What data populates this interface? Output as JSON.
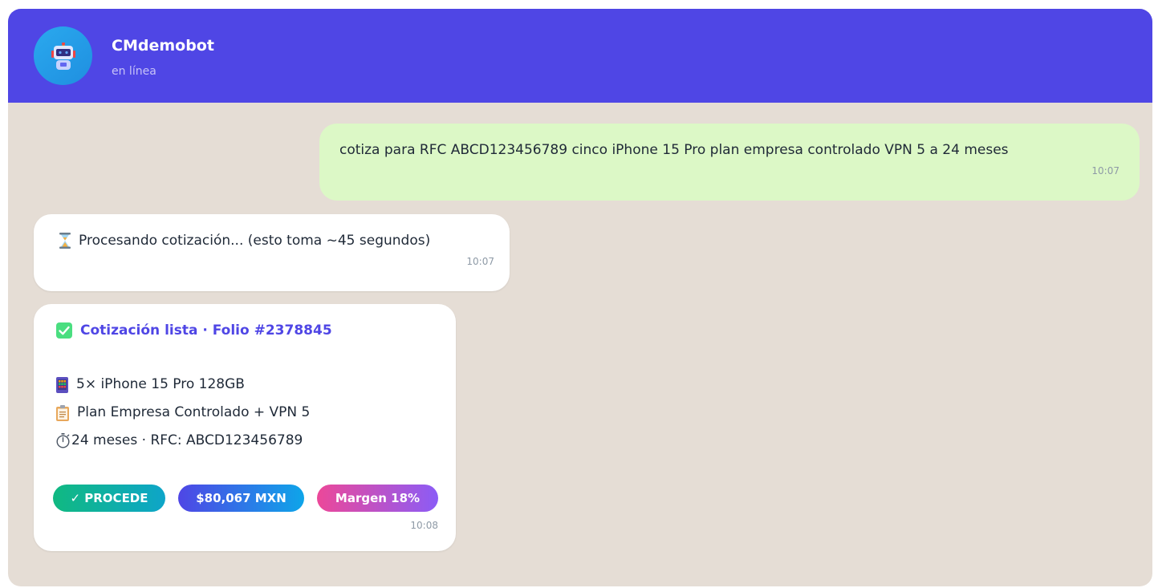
{
  "header": {
    "bot_name": "CMdemobot",
    "status": "en línea",
    "avatar_icon": "robot-icon",
    "color": "#4f46e5"
  },
  "messages": [
    {
      "direction": "outgoing",
      "text": "cotiza para RFC ABCD123456789 cinco iPhone 15 Pro plan empresa controlado VPN 5 a 24 meses",
      "time": "10:07"
    },
    {
      "direction": "incoming",
      "icon": "hourglass-icon",
      "text": "Procesando cotización... (esto toma ~45 segundos)",
      "time": "10:07"
    },
    {
      "direction": "incoming",
      "title_icon": "check-box-icon",
      "title": "Cotización lista · Folio #2378845",
      "lines": [
        {
          "icon": "phone-icon",
          "text": "5× iPhone 15 Pro 128GB"
        },
        {
          "icon": "clipboard-icon",
          "text": "Plan Empresa Controlado + VPN 5"
        },
        {
          "icon": "stopwatch-icon",
          "text": "24 meses · RFC: ABCD123456789"
        }
      ],
      "badges": [
        {
          "label": "✓ PROCEDE",
          "colors": [
            "#10b981",
            "#0ea5c9"
          ]
        },
        {
          "label": "$80,067 MXN",
          "colors": [
            "#4f46e5",
            "#0ea5e9"
          ]
        },
        {
          "label": "Margen 18%",
          "colors": [
            "#ec4899",
            "#8b5cf6"
          ]
        }
      ],
      "time": "10:08"
    }
  ],
  "colors": {
    "chat_background": "#e5ddd5",
    "outgoing_bubble": "#dcf8c6",
    "incoming_bubble": "#ffffff",
    "accent": "#4f46e5"
  }
}
